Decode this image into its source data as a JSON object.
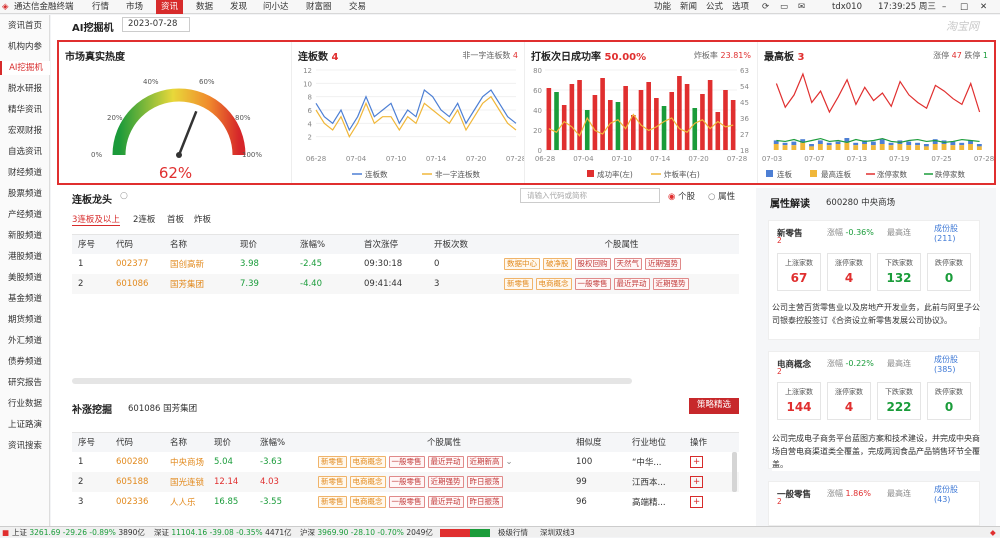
{
  "topbar": {
    "app_title": "通达信金融终端",
    "menus": [
      "行情",
      "市场",
      "资讯",
      "数据",
      "发现",
      "问小达",
      "财富圈",
      "交易"
    ],
    "active_menu": "资讯",
    "right_items": [
      "功能",
      "新闻",
      "公式",
      "选项"
    ],
    "user": "tdx010",
    "time": "17:39:25 周三"
  },
  "sidebar": [
    "资讯首页",
    "机构内参",
    "AI挖掘机",
    "脱水研报",
    "精华资讯",
    "宏观财报",
    "自选资讯",
    "财经频道",
    "股票频道",
    "产经频道",
    "新股频道",
    "港股频道",
    "美股频道",
    "基金频道",
    "期货频道",
    "外汇频道",
    "债券频道",
    "研究报告",
    "行业数据",
    "上证路演",
    "资讯搜索"
  ],
  "sidebar_active": "AI挖掘机",
  "header": {
    "title": "AI挖掘机",
    "date": "2023-07-28",
    "watermark": "淘宝网"
  },
  "heat": {
    "title": "市场真实热度",
    "value": "62%",
    "ticks": [
      "0%",
      "20%",
      "40%",
      "60%",
      "80%",
      "100%"
    ],
    "level": 62
  },
  "lianban": {
    "title": "连板数",
    "count": "4",
    "right_label": "非一字连板数",
    "right_count": "4",
    "legend": [
      "连板数",
      "非一字连板数"
    ],
    "chart_data": {
      "type": "line",
      "x": [
        "06-28",
        "07-04",
        "07-10",
        "07-14",
        "07-20",
        "07-28"
      ],
      "yticks": [
        "2",
        "4",
        "6",
        "8",
        "10",
        "12"
      ],
      "ylim": [
        0,
        12
      ],
      "series": [
        {
          "name": "连板数",
          "color": "#4d7fd4",
          "values": [
            7,
            5,
            4,
            6,
            3,
            5,
            8,
            5,
            6,
            7,
            4,
            6,
            5,
            9,
            8,
            6,
            5,
            7,
            4,
            6,
            8,
            9,
            7,
            5,
            4
          ]
        },
        {
          "name": "非一字连板数",
          "color": "#f0b73a",
          "values": [
            6,
            4,
            3,
            5,
            2,
            4,
            7,
            4,
            5,
            5,
            3,
            5,
            4,
            7,
            6,
            5,
            4,
            6,
            3,
            5,
            7,
            8,
            6,
            4,
            3
          ]
        }
      ]
    }
  },
  "success": {
    "title": "打板次日成功率",
    "value": "50.00%",
    "right_label": "炸板率",
    "right_value": "23.81%",
    "legend": [
      "成功率(左)",
      "炸板率(右)"
    ],
    "chart_data": {
      "type": "bar",
      "x": [
        "06-28",
        "07-04",
        "07-10",
        "07-14",
        "07-20",
        "07-28"
      ],
      "yticks_left": [
        "0",
        "20",
        "40",
        "60",
        "80"
      ],
      "yticks_right": [
        "18",
        "27",
        "36",
        "45",
        "54",
        "63"
      ],
      "ylim": [
        0,
        80
      ],
      "bars": [
        62,
        58,
        45,
        66,
        70,
        40,
        55,
        72,
        50,
        48,
        64,
        35,
        60,
        68,
        52,
        44,
        58,
        74,
        66,
        42,
        56,
        70,
        38,
        60,
        50
      ],
      "bar_colors": [
        "#e02f2f",
        "#1a9c3a",
        "#e02f2f",
        "#e02f2f",
        "#e02f2f",
        "#1a9c3a",
        "#e02f2f",
        "#e02f2f",
        "#e02f2f",
        "#1a9c3a",
        "#e02f2f",
        "#e02f2f",
        "#e02f2f",
        "#e02f2f",
        "#e02f2f",
        "#1a9c3a",
        "#e02f2f",
        "#e02f2f",
        "#e02f2f",
        "#1a9c3a",
        "#e02f2f",
        "#e02f2f",
        "#e02f2f",
        "#e02f2f",
        "#e02f2f"
      ],
      "line": [
        30,
        28,
        34,
        31,
        26,
        36,
        29,
        27,
        33,
        35,
        30,
        38,
        32,
        29,
        31,
        34,
        36,
        30,
        28,
        33,
        35,
        30,
        34,
        31,
        32
      ]
    }
  },
  "highest": {
    "title": "最高板",
    "count": "3",
    "zt_label": "涨停",
    "zt_count": "47",
    "dt_label": "跌停",
    "dt_count": "1",
    "legend": [
      "连板",
      "最高连板",
      "涨停家数",
      "跌停家数"
    ],
    "chart_data": {
      "type": "line",
      "x": [
        "07-03",
        "07-07",
        "07-13",
        "07-19",
        "07-25",
        "07-28"
      ],
      "zt": [
        70,
        45,
        58,
        80,
        50,
        62,
        40,
        56,
        74,
        48,
        66,
        52,
        60,
        46,
        72,
        58,
        50,
        44,
        68,
        62,
        54,
        48,
        70,
        40
      ],
      "lb": [
        8,
        6,
        7,
        9,
        5,
        8,
        6,
        7,
        10,
        6,
        8,
        7,
        9,
        6,
        8,
        7,
        6,
        5,
        9,
        8,
        7,
        6,
        8,
        5
      ],
      "hb": [
        5,
        4,
        4,
        6,
        3,
        5,
        4,
        5,
        6,
        4,
        5,
        4,
        5,
        4,
        5,
        4,
        4,
        3,
        5,
        5,
        4,
        4,
        5,
        3
      ],
      "dt": [
        10,
        9,
        11,
        8,
        10,
        12,
        9,
        10,
        8,
        11,
        9,
        10,
        12,
        9,
        8,
        10,
        11,
        9,
        10,
        8,
        9,
        11,
        10,
        9
      ]
    }
  },
  "dragon": {
    "title": "连板龙头",
    "search_placeholder": "请输入代码或简称",
    "radio1": "个股",
    "radio2": "属性",
    "subtabs": [
      "3连板及以上",
      "2连板",
      "首板",
      "炸板"
    ],
    "columns": [
      "序号",
      "代码",
      "名称",
      "现价",
      "涨幅%",
      "首次涨停",
      "开板次数",
      "个股属性"
    ],
    "rows": [
      {
        "no": "1",
        "code": "002377",
        "name": "国创高新",
        "price": "3.98",
        "chg": "-2.45",
        "first": "09:30:18",
        "open": "0",
        "tags": [
          "数据中心",
          "破净股",
          "超跌"
        ]
      },
      {
        "no": "2",
        "code": "601086",
        "name": "国芳集团",
        "price": "7.39",
        "chg": "-4.40",
        "first": "09:41:44",
        "open": "3",
        "tags": [
          "新零售",
          "电商概念",
          "一般零售",
          "最近异动",
          "近期强势"
        ]
      }
    ],
    "row1_tags_r": [
      "股权回购",
      "天然气",
      "近期强势"
    ]
  },
  "buzhang": {
    "title": "补涨挖掘",
    "stock": "601086 国芳集团",
    "button": "策略精选",
    "columns": [
      "序号",
      "代码",
      "名称",
      "现价",
      "涨幅%",
      "个股属性",
      "相似度",
      "行业地位",
      "操作"
    ],
    "rows": [
      {
        "no": "1",
        "code": "600280",
        "name": "中央商场",
        "price": "5.04",
        "chg": "-3.63",
        "tags": [
          "新零售",
          "电商概念",
          "一般零售",
          "最近异动",
          "近期新高"
        ],
        "sim": "100",
        "pos": "“中华..."
      },
      {
        "no": "2",
        "code": "605188",
        "name": "国光连锁",
        "price": "12.14",
        "chg": "4.03",
        "tags": [
          "新零售",
          "电商概念",
          "一般零售",
          "近期强势",
          "昨日振荡"
        ],
        "sim": "99",
        "pos": "江西本..."
      },
      {
        "no": "3",
        "code": "002336",
        "name": "人人乐",
        "price": "16.85",
        "chg": "-3.55",
        "tags": [
          "新零售",
          "电商概念",
          "一般零售",
          "最近异动",
          "昨日振荡"
        ],
        "sim": "96",
        "pos": "高端精..."
      }
    ]
  },
  "attr": {
    "title": "属性解读",
    "stock": "600280 中央商场",
    "blocks": [
      {
        "name": "新零售",
        "chg_label": "涨幅",
        "chg": "-0.36%",
        "hb_label": "最高连",
        "count": "2",
        "link": "成份股",
        "link_n": "(211)",
        "stats": [
          {
            "l": "上涨家数",
            "v": "67",
            "c": "red"
          },
          {
            "l": "涨停家数",
            "v": "4",
            "c": "red"
          },
          {
            "l": "下跌家数",
            "v": "132",
            "c": "green"
          },
          {
            "l": "跌停家数",
            "v": "0",
            "c": "green"
          }
        ],
        "desc": "公司主营百货零售业以及房地产开发业务，此前与阿里子公司银泰控股签订《合资设立新零售发展公司协议》。"
      },
      {
        "name": "电商概念",
        "chg_label": "涨幅",
        "chg": "-0.22%",
        "hb_label": "最高连",
        "count": "2",
        "link": "成份股",
        "link_n": "(385)",
        "stats": [
          {
            "l": "上涨家数",
            "v": "144",
            "c": "red"
          },
          {
            "l": "涨停家数",
            "v": "4",
            "c": "red"
          },
          {
            "l": "下跌家数",
            "v": "222",
            "c": "green"
          },
          {
            "l": "跌停家数",
            "v": "0",
            "c": "green"
          }
        ],
        "desc": "公司完成电子商务平台蓝图方案和技术建设，并完成中央商场自营电商渠道类全覆盖，完成两润食品产品销售环节全覆盖。"
      },
      {
        "name": "一般零售",
        "chg_label": "涨幅",
        "chg": "1.86%",
        "hb_label": "最高连",
        "count": "2",
        "link": "成份股",
        "link_n": "(43)"
      }
    ]
  },
  "status": {
    "items": [
      {
        "label": "上证",
        "v": "3261.69",
        "c1": "-29.26",
        "c2": "-0.89%",
        "amt": "3890亿"
      },
      {
        "label": "深证",
        "v": "11104.16",
        "c1": "-39.08",
        "c2": "-0.35%",
        "amt": "4471亿"
      },
      {
        "label": "沪深",
        "v": "3969.90",
        "c1": "-28.10",
        "c2": "-0.70%",
        "amt": "2049亿"
      }
    ],
    "right": [
      "极级行情",
      "深圳双线3"
    ]
  }
}
